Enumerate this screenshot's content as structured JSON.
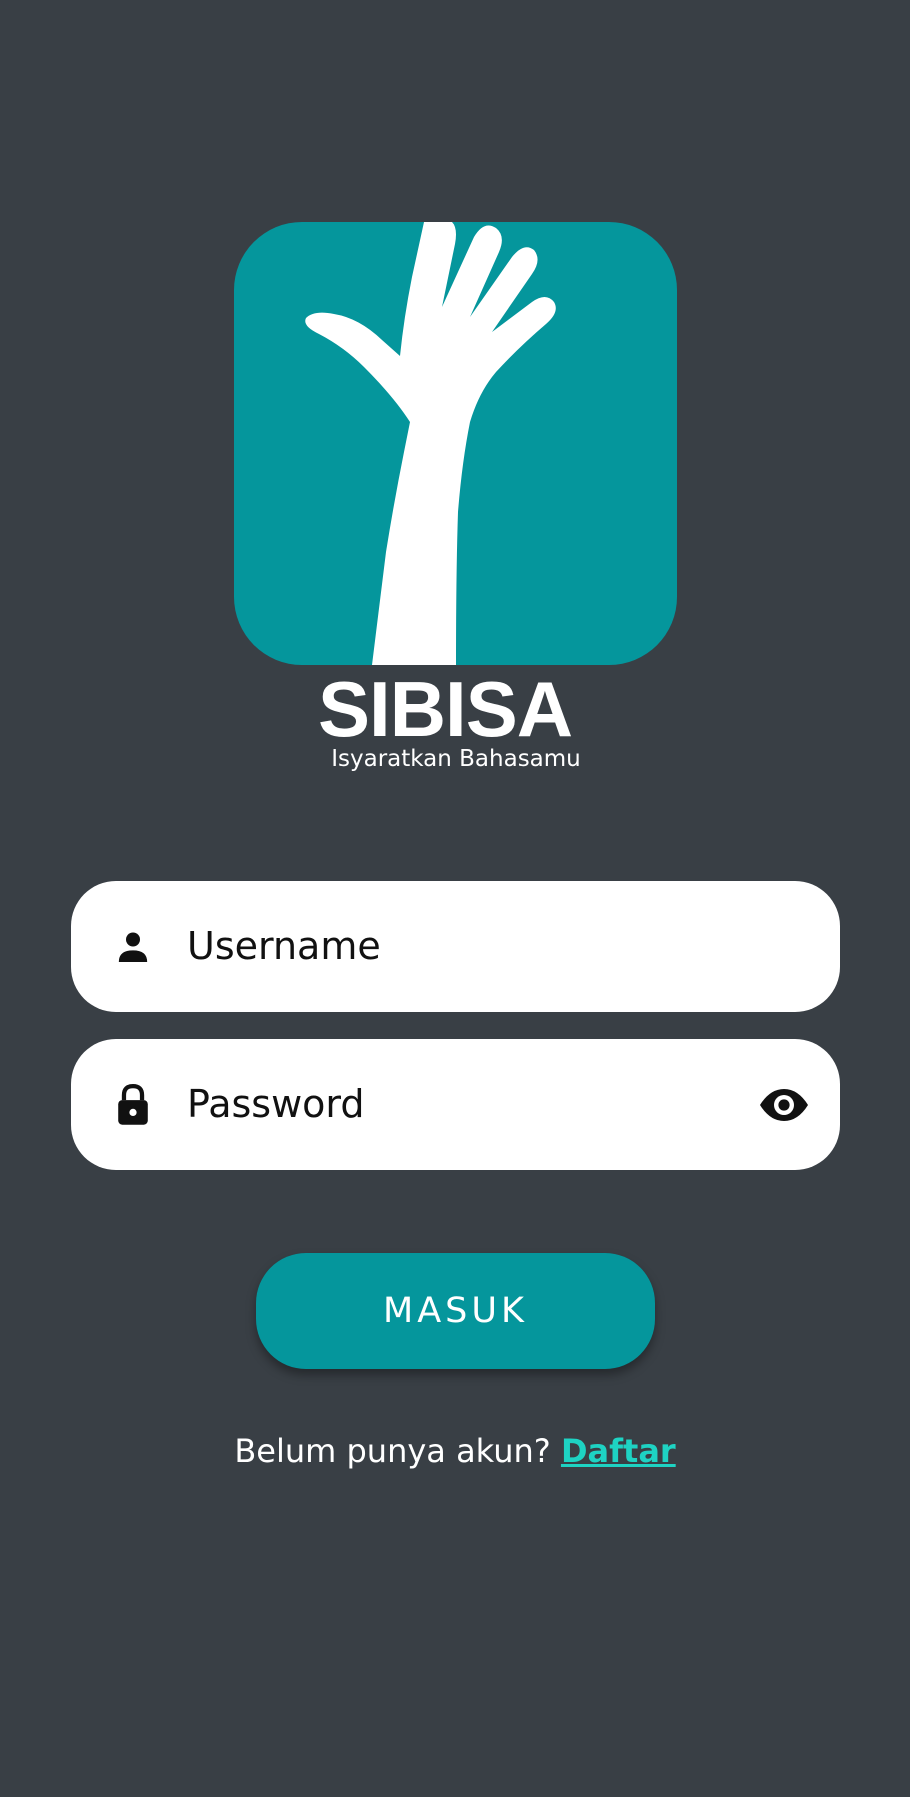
{
  "brand": {
    "name": "SIBISA",
    "tagline": "Isyaratkan Bahasamu"
  },
  "form": {
    "username": {
      "placeholder": "Username",
      "icon": "person-icon"
    },
    "password": {
      "placeholder": "Password",
      "icon": "lock-icon",
      "toggle_icon": "eye-icon"
    },
    "submit_label": "MASUK"
  },
  "register": {
    "prompt": "Belum punya akun?",
    "link_label": "Daftar"
  },
  "colors": {
    "background": "#393f45",
    "accent": "#05969c",
    "link": "#1ed3c3",
    "field": "#ffffff"
  }
}
